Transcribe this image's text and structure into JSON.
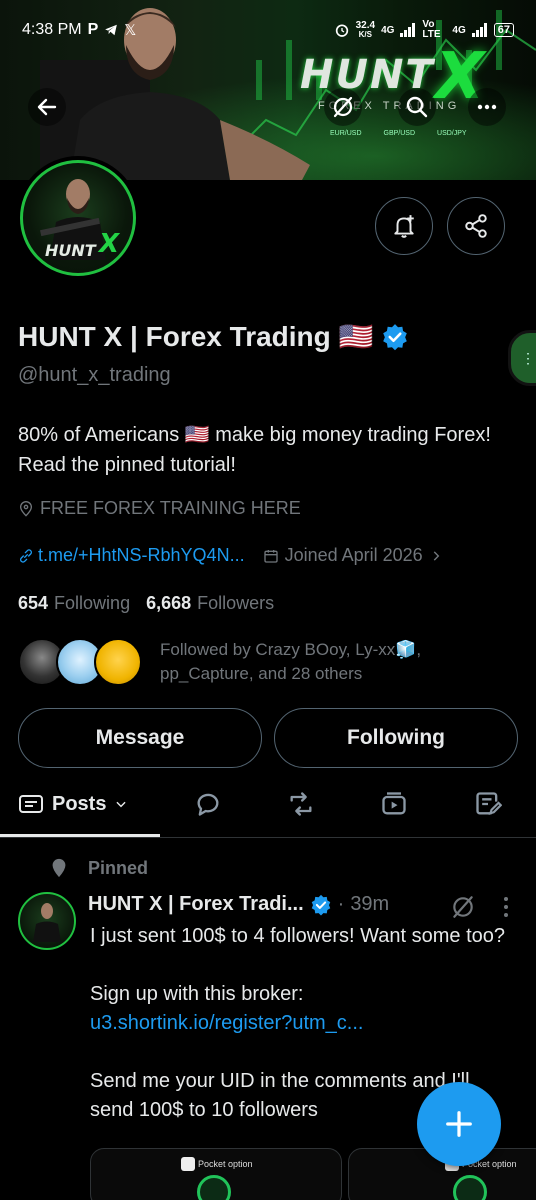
{
  "status_bar": {
    "time": "4:38 PM",
    "speed": "32.4",
    "speed_unit": "K/S",
    "network1": "4G",
    "network2": "Vo LTE",
    "network3": "4G",
    "battery": "67"
  },
  "banner": {
    "logo": "HUNT",
    "logo_x": "X",
    "subtitle": "FOREX TRADING",
    "pairs": [
      "EUR/USD",
      "GBP/USD",
      "USD/JPY"
    ]
  },
  "avatar": {
    "label": "HUNT",
    "x": "X"
  },
  "profile": {
    "display_name": "HUNT X | Forex Trading 🇺🇸",
    "handle": "@hunt_x_trading",
    "bio": "80% of Americans 🇺🇸 make big money trading Forex! Read the pinned tutorial!",
    "location": "FREE FOREX TRAINING HERE",
    "link": "t.me/+HhtNS-RbhYQ4N...",
    "joined": "Joined April 2026",
    "following_count": "654",
    "following_label": "Following",
    "followers_count": "6,668",
    "followers_label": "Followers",
    "followed_by": "Followed by Crazy BOoy, Ly-xx🧊, pp_Capture, and 28 others"
  },
  "actions": {
    "message": "Message",
    "following": "Following"
  },
  "tabs": {
    "posts": "Posts"
  },
  "post": {
    "pinned_label": "Pinned",
    "author": "HUNT X | Forex Tradi...",
    "time": "39m",
    "line1": "I just sent 100$ to 4 followers! Want some too?",
    "line2_prefix": "Sign up with this broker: ",
    "line2_url": "u3.shortink.io/register?utm_c...",
    "line3": "Send me your UID in the comments and I'll send 100$ to 10 followers",
    "card_brand": "Pocket option"
  },
  "colors": {
    "accent": "#1d9bf0",
    "verified": "#1d9bf0",
    "brand_green": "#1cdc3e",
    "muted": "#71767b"
  }
}
